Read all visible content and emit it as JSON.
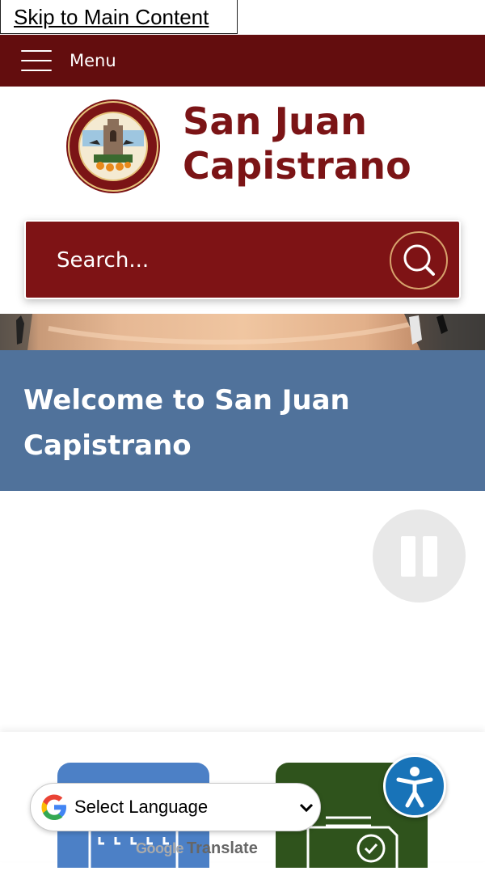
{
  "skip_link": "Skip to Main Content",
  "topbar": {
    "menu_label": "Menu",
    "background": "#630d0e"
  },
  "header": {
    "brand_line1": "San Juan",
    "brand_line2": "Capistrano",
    "brand_color": "#7b1416",
    "seal_icon": "city-seal-icon"
  },
  "search": {
    "placeholder": "Search...",
    "icon": "search-icon",
    "background": "#7e1315"
  },
  "welcome": {
    "title": "Welcome to San Juan Capistrano",
    "background": "#50729b"
  },
  "slideshow": {
    "pause_icon": "pause-icon"
  },
  "translate": {
    "select_label": "Select Language",
    "powered_brand": "Google",
    "powered_label": "Translate"
  },
  "accessibility": {
    "icon": "accessibility-icon",
    "color": "#1873b8"
  },
  "quick_links": [
    {
      "icon": "calendar-icon",
      "color": "#4c80c6"
    },
    {
      "icon": "certificate-icon",
      "color": "#2f531c"
    }
  ]
}
